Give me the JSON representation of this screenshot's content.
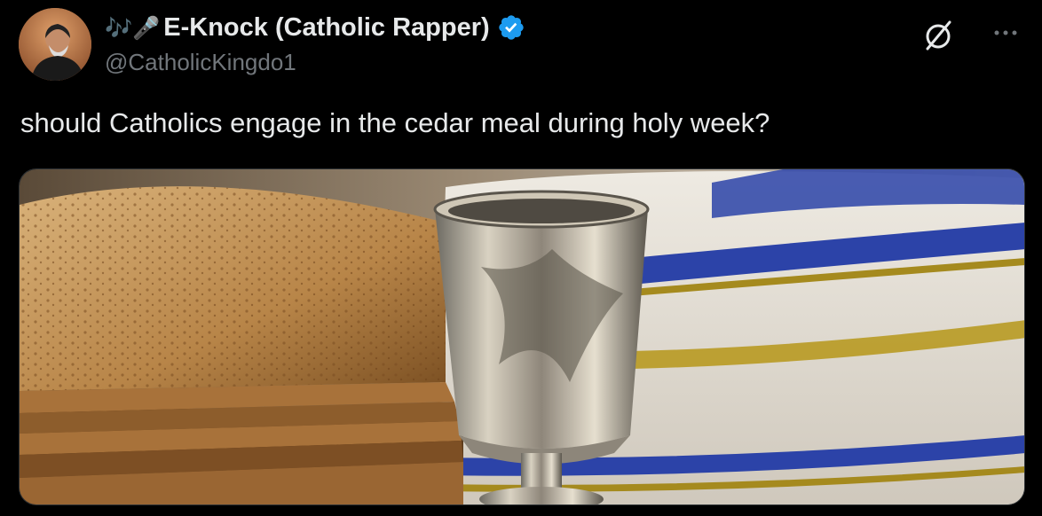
{
  "tweet": {
    "emoji": "🎶🎤",
    "display_name": "E-Knock (Catholic Rapper)",
    "handle": "@CatholicKingdo1",
    "verified": true,
    "text": "should Catholics engage in the cedar meal during holy week?"
  },
  "actions": {
    "grok_icon": "grok-icon",
    "more_icon": "more-horizontal-icon"
  },
  "colors": {
    "background": "#000000",
    "text_primary": "#e7e9ea",
    "text_secondary": "#71767b",
    "verified_blue": "#1d9bf0"
  }
}
